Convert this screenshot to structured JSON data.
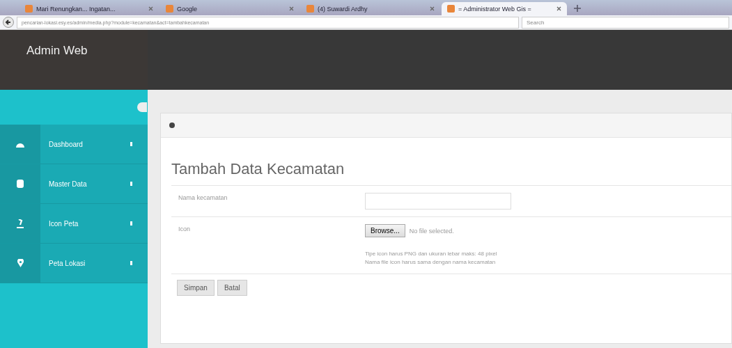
{
  "browser": {
    "tabs": [
      {
        "title": "Mari Renungkan... Ingatan...",
        "selected": false
      },
      {
        "title": "Google",
        "selected": false
      },
      {
        "title": "(4) Suwardi Ardhy",
        "selected": false
      },
      {
        "title": "= Administrator Web Gis =",
        "selected": true
      }
    ],
    "url": "pencarian-lokasi.esy.es/admin/media.php?module=kecamatan&act=tambahkecamatan",
    "search_placeholder": "Search"
  },
  "brand": "Admin Web",
  "sidebar": {
    "items": [
      {
        "label": "Dashboard"
      },
      {
        "label": "Master Data"
      },
      {
        "label": "Icon Peta"
      },
      {
        "label": "Peta Lokasi"
      }
    ]
  },
  "form": {
    "title": "Tambah Data Kecamatan",
    "fields": [
      {
        "kind": "text",
        "label": "Nama kecamatan"
      },
      {
        "kind": "file",
        "label": "Icon",
        "button": "Browse...",
        "status": "No file selected.",
        "help": [
          "Tipe icon harus PNG dan ukuran lebar maks: 48 pixel",
          "Nama file icon harus sama dengan nama kecamatan"
        ]
      }
    ],
    "buttons": [
      "Simpan",
      "Batal"
    ]
  }
}
